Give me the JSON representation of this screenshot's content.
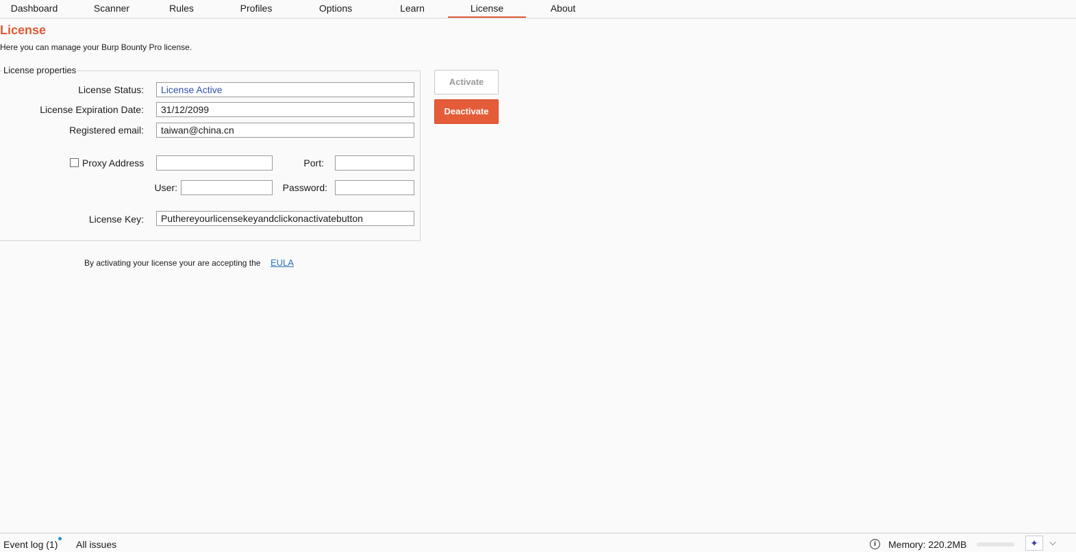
{
  "tabs": [
    {
      "label": "Dashboard"
    },
    {
      "label": "Scanner"
    },
    {
      "label": "Rules"
    },
    {
      "label": "Profiles"
    },
    {
      "label": "Options"
    },
    {
      "label": "Learn"
    },
    {
      "label": "License",
      "active": true
    },
    {
      "label": "About"
    }
  ],
  "page": {
    "title": "License",
    "description": "Here you can manage your Burp Bounty Pro license."
  },
  "properties": {
    "legend": "License properties",
    "status_label": "License Status:",
    "status_value": "License Active",
    "expiration_label": "License Expiration Date:",
    "expiration_value": "31/12/2099",
    "email_label": "Registered email:",
    "email_value": "taiwan@china.cn",
    "proxy_label": "Proxy Address",
    "proxy_checked": false,
    "proxy_value": "",
    "port_label": "Port:",
    "port_value": "",
    "user_label": "User:",
    "user_value": "",
    "password_label": "Password:",
    "password_value": "",
    "key_label": "License Key:",
    "key_value": "Puthereyourlicensekeyandclickonactivatebutton"
  },
  "buttons": {
    "activate": "Activate",
    "deactivate": "Deactivate"
  },
  "eula": {
    "text": "By activating your license your are accepting the",
    "link": "EULA"
  },
  "statusbar": {
    "event_log": "Event log (1)",
    "all_issues": "All issues",
    "memory": "Memory: 220.2MB",
    "memory_usage_fraction": 0.0,
    "chevron": "⌵",
    "sparkle": "✦"
  },
  "colors": {
    "accent": "#e05b36",
    "link": "#2d6fb5",
    "status_text": "#2c4fb5"
  }
}
